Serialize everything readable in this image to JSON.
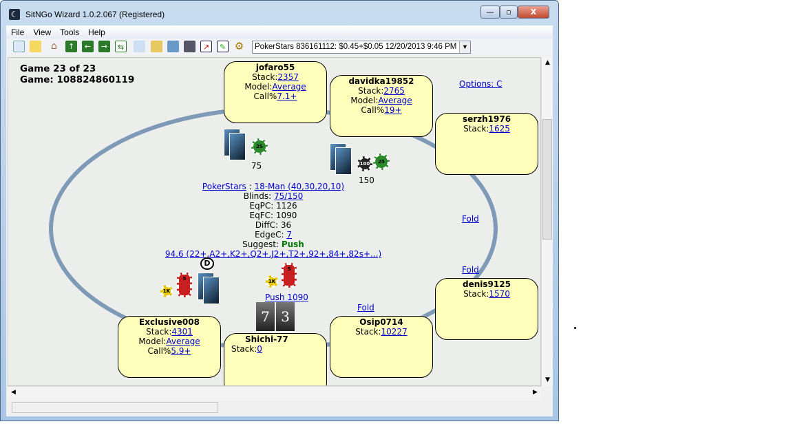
{
  "window": {
    "title": "SitNGo Wizard 1.0.2.067 (Registered)",
    "minimize": "—",
    "maximize": "▫",
    "close": "X"
  },
  "menu": [
    "File",
    "View",
    "Tools",
    "Help"
  ],
  "toolbar": {
    "icons": [
      "new-icon",
      "open-icon",
      "home-icon",
      "up-icon",
      "back-icon",
      "forward-icon",
      "refresh-icon",
      "copy-icon",
      "paste-icon",
      "image-icon",
      "calculator-icon",
      "chart-icon",
      "edit-icon",
      "settings-icon"
    ],
    "tournament_select": "PokerStars 836161112: $0.45+$0.05 12/20/2013 9:46 PM"
  },
  "info": {
    "game_of": "Game 23 of 23",
    "game_id": "Game: 108824860119"
  },
  "options_link": "Options: C",
  "players": [
    {
      "name": "jofaro55",
      "stack_label": "Stack:",
      "stack": "2357",
      "model_label": "Model:",
      "model": "Average",
      "call_label": "Call%",
      "call": "7.1+"
    },
    {
      "name": "davidka19852",
      "stack_label": "Stack:",
      "stack": "2765",
      "model_label": "Model:",
      "model": "Average",
      "call_label": "Call%",
      "call": "19+"
    },
    {
      "name": "serzh1976",
      "stack_label": "Stack:",
      "stack": "1625"
    },
    {
      "name": "denis9125",
      "stack_label": "Stack:",
      "stack": "1570"
    },
    {
      "name": "Osip0714",
      "stack_label": "Stack:",
      "stack": "10227"
    },
    {
      "name": "Shichi-77",
      "stack_label": "Stack:",
      "stack": "0"
    },
    {
      "name": "Exclusive008",
      "stack_label": "Stack:",
      "stack": "4301",
      "model_label": "Model:",
      "model": "Average",
      "call_label": "Call%",
      "call": "5.9+"
    }
  ],
  "bets": {
    "jofaro55": "75",
    "davidka19852": "150",
    "hero_action": "Push 1090"
  },
  "actions": {
    "serzh1976": "Fold",
    "denis9125": "Fold",
    "osip0714": "Fold"
  },
  "chips": {
    "small": "25",
    "big1": "100",
    "big2": "25",
    "k": "1K",
    "five": "5",
    "dealer": "D"
  },
  "hole_cards": [
    "7",
    "3"
  ],
  "summary": {
    "site": "PokerStars",
    "sep": " : ",
    "structure": "18-Man (40,30,20,10)",
    "blinds_label": "Blinds: ",
    "blinds": "75/150",
    "eqpc_label": "EqPC: ",
    "eqpc": "1126",
    "eqfc_label": "EqFC: ",
    "eqfc": "1090",
    "diffc_label": "DiffC: ",
    "diffc": "36",
    "edgec_label": "EdgeC: ",
    "edgec": "7",
    "suggest_label": "Suggest: ",
    "suggest": "Push",
    "range": "94.6 (22+,A2+,K2+,Q2+,J2+,T2+,92+,84+,82s+...)"
  },
  "colors": {
    "suggest": "#007700",
    "player_box": "#ffffbb",
    "table_rail": "#7f9ab6"
  }
}
